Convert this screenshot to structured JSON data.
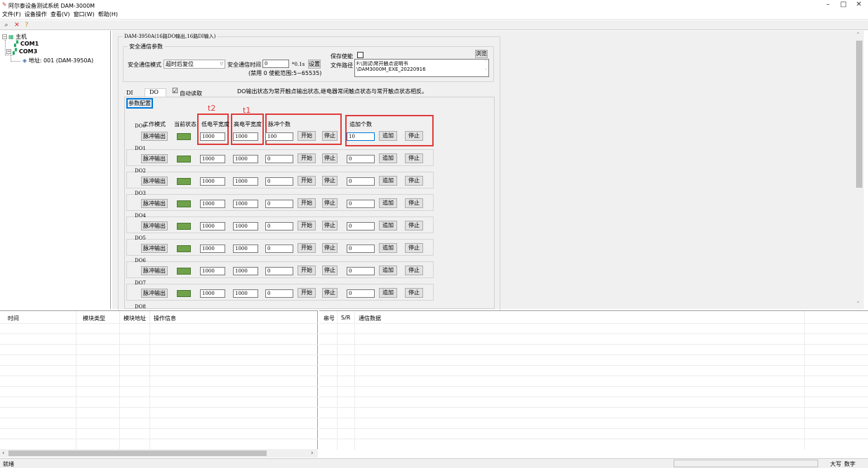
{
  "app": {
    "title": "阿尔泰设备测试系统 DAM-3000M"
  },
  "window_controls": {
    "minimize": "–",
    "maximize": "□",
    "close": "✕"
  },
  "menu": [
    "文件(F)",
    "设备操作",
    "查看(V)",
    "窗口(W)",
    "帮助(H)"
  ],
  "toolbar": {
    "search_icon": "⌕",
    "close_icon": "✕",
    "help_icon": "?"
  },
  "tree": {
    "root": "主机",
    "com1": "COM1",
    "com3": "COM3",
    "address": "地址: 001 (DAM-3950A)",
    "expand_glyph": "−"
  },
  "module_group": {
    "title": "DAM-3950A(16路DO输出,16路DI输入)"
  },
  "safety": {
    "title": "安全通信参数",
    "mode_label": "安全通信模式",
    "mode_value": "超时后复位",
    "time_label": "安全通信时间",
    "time_value": "0",
    "time_unit": "*0.1s",
    "set_button": "设置",
    "hint": "(禁用 0 使能范围:5~65535)",
    "save_enable_label": "保存使能",
    "path_label": "文件路径",
    "path_value_1": "F:\\测试\\常开触点说明书",
    "path_value_2": "\\DAM3000M_EXE_20220916",
    "browse_button": "浏览"
  },
  "tabs": {
    "di": "DI",
    "do": "DO"
  },
  "auto_read": {
    "label": "自动读取",
    "checked": "☑"
  },
  "do_note": "DO输出状态为常开触点输出状态,继电器常闭触点状态与常开触点状态相反。",
  "param_config_button": "参数配置",
  "annotations": {
    "t2": "t2",
    "t1": "t1"
  },
  "headers": {
    "work_mode": "工作模式",
    "current_state": "当前状态",
    "low_width": "低电平宽度",
    "high_width": "高电平宽度",
    "pulse_count": "脉冲个数",
    "append_count": "追加个数"
  },
  "channels": [
    {
      "name": "DO0",
      "mode": "脉冲输出",
      "low": "1000",
      "high": "1000",
      "pulse": "100",
      "start": "开始",
      "stop1": "停止",
      "append": "10",
      "add": "追加",
      "stop2": "停止"
    },
    {
      "name": "DO1",
      "mode": "脉冲输出",
      "low": "1000",
      "high": "1000",
      "pulse": "0",
      "start": "开始",
      "stop1": "停止",
      "append": "0",
      "add": "追加",
      "stop2": "停止"
    },
    {
      "name": "DO2",
      "mode": "脉冲输出",
      "low": "1000",
      "high": "1000",
      "pulse": "0",
      "start": "开始",
      "stop1": "停止",
      "append": "0",
      "add": "追加",
      "stop2": "停止"
    },
    {
      "name": "DO3",
      "mode": "脉冲输出",
      "low": "1000",
      "high": "1000",
      "pulse": "0",
      "start": "开始",
      "stop1": "停止",
      "append": "0",
      "add": "追加",
      "stop2": "停止"
    },
    {
      "name": "DO4",
      "mode": "脉冲输出",
      "low": "1000",
      "high": "1000",
      "pulse": "0",
      "start": "开始",
      "stop1": "停止",
      "append": "0",
      "add": "追加",
      "stop2": "停止"
    },
    {
      "name": "DO5",
      "mode": "脉冲输出",
      "low": "1000",
      "high": "1000",
      "pulse": "0",
      "start": "开始",
      "stop1": "停止",
      "append": "0",
      "add": "追加",
      "stop2": "停止"
    },
    {
      "name": "DO6",
      "mode": "脉冲输出",
      "low": "1000",
      "high": "1000",
      "pulse": "0",
      "start": "开始",
      "stop1": "停止",
      "append": "0",
      "add": "追加",
      "stop2": "停止"
    },
    {
      "name": "DO7",
      "mode": "脉冲输出",
      "low": "1000",
      "high": "1000",
      "pulse": "0",
      "start": "开始",
      "stop1": "停止",
      "append": "0",
      "add": "追加",
      "stop2": "停止"
    }
  ],
  "next_channel": "DO8",
  "log_left": {
    "time": "时间",
    "module_type": "模块类型",
    "module_address": "模块地址",
    "operation": "操作信息"
  },
  "log_right": {
    "serial": "串号",
    "sr": "S/R",
    "data": "通信数据"
  },
  "scroll": {
    "up": "˄",
    "down": "˅",
    "left": "‹",
    "right": "›"
  },
  "status": {
    "ready": "就绪",
    "caps": "大写",
    "num": "数字"
  },
  "colors": {
    "led_on": "#6fa24a",
    "annotation": "#e03b3b",
    "focus": "#0078d7"
  }
}
